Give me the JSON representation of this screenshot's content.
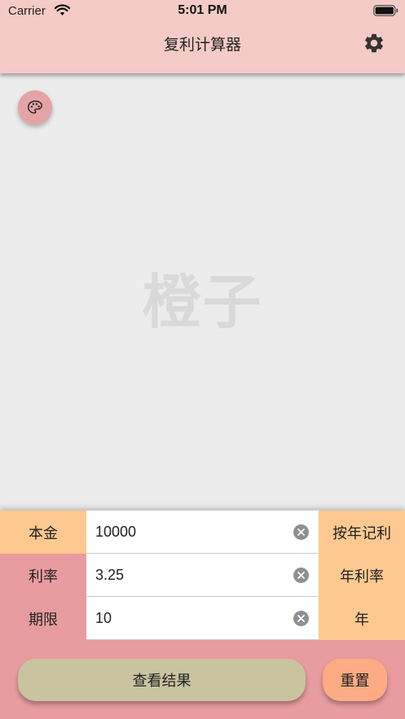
{
  "status_bar": {
    "carrier": "Carrier",
    "time": "5:01 PM",
    "wifi_icon": "wifi-icon",
    "battery_icon": "battery-icon"
  },
  "nav": {
    "title": "复利计算器",
    "settings_icon": "gear-icon"
  },
  "content": {
    "palette_icon": "palette-icon",
    "watermark": "橙子"
  },
  "form": {
    "rows": [
      {
        "label": "本金",
        "value": "10000",
        "unit": "按年记利"
      },
      {
        "label": "利率",
        "value": "3.25",
        "unit": "年利率"
      },
      {
        "label": "期限",
        "value": "10",
        "unit": "年"
      }
    ],
    "clear_icon": "clear-icon",
    "result_button": "查看结果",
    "reset_button": "重置"
  },
  "colors": {
    "header": "#f4cbc6",
    "background": "#ececec",
    "peach": "#fdc991",
    "pink": "#e89c9f",
    "result_button": "#c9c49f",
    "reset_button": "#fdab84"
  }
}
